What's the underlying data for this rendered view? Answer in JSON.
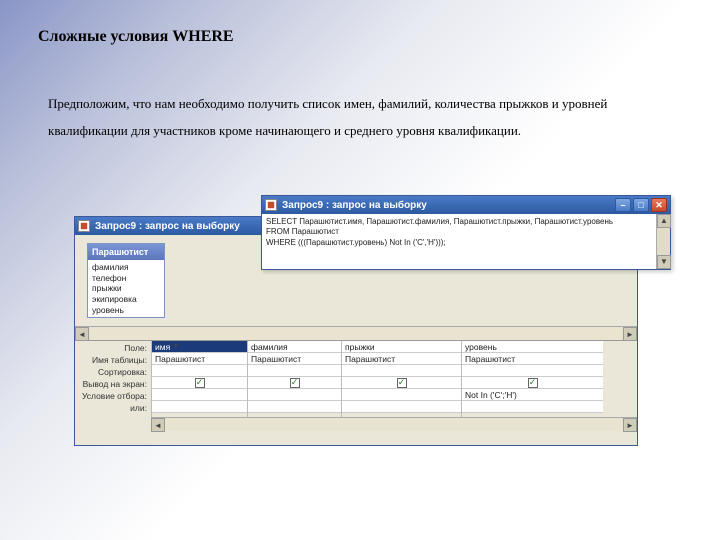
{
  "heading": "Сложные условия WHERE",
  "paragraph": "Предположим, что нам необходимо получить список имен, фамилий, количества прыжков и уровней квалификации для участников кроме начинающего и среднего уровня квалификации.",
  "qbe_window": {
    "title": "Запрос9 : запрос на выборку",
    "field_list": {
      "header": "Парашютист",
      "items": [
        "фамилия",
        "телефон",
        "прыжки",
        "экипировка",
        "уровень"
      ]
    },
    "grid": {
      "row_labels": [
        "Поле:",
        "Имя таблицы:",
        "Сортировка:",
        "Вывод на экран:",
        "Условие отбора:",
        "или:"
      ],
      "columns": [
        {
          "field": "имя",
          "table": "Парашютист",
          "show": true,
          "criteria": ""
        },
        {
          "field": "фамилия",
          "table": "Парашютист",
          "show": true,
          "criteria": ""
        },
        {
          "field": "прыжки",
          "table": "Парашютист",
          "show": true,
          "criteria": ""
        },
        {
          "field": "уровень",
          "table": "Парашютист",
          "show": true,
          "criteria": "Not In ('С';'Н')"
        }
      ]
    }
  },
  "sql_window": {
    "title": "Запрос9 : запрос на выборку",
    "lines": [
      "SELECT Парашютист.имя, Парашютист.фамилия, Парашютист.прыжки, Парашютист.уровень",
      "FROM Парашютист",
      "WHERE (((Парашютист.уровень) Not In ('С','Н')));"
    ]
  },
  "icons": {
    "check": "✓",
    "left": "◄",
    "right": "►",
    "up": "▲",
    "down": "▼",
    "min": "–",
    "max": "□",
    "close": "✕"
  }
}
